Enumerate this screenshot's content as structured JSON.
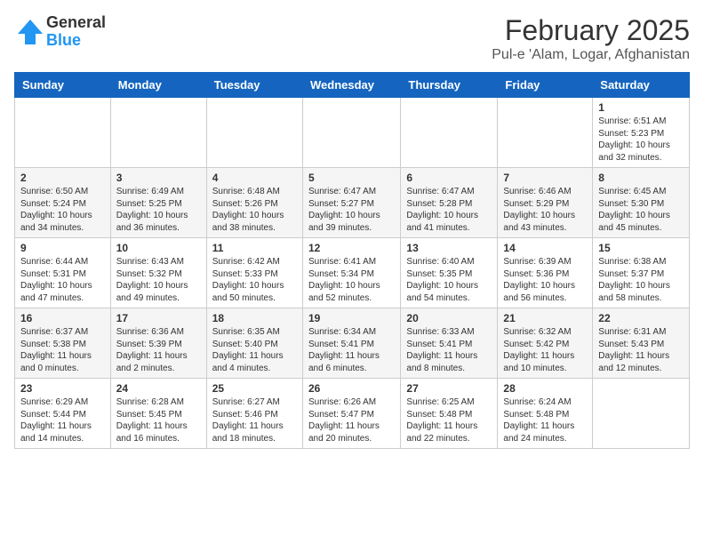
{
  "header": {
    "logo_general": "General",
    "logo_blue": "Blue",
    "title": "February 2025",
    "subtitle": "Pul-e 'Alam, Logar, Afghanistan"
  },
  "days_of_week": [
    "Sunday",
    "Monday",
    "Tuesday",
    "Wednesday",
    "Thursday",
    "Friday",
    "Saturday"
  ],
  "weeks": [
    [
      {
        "day": "",
        "info": ""
      },
      {
        "day": "",
        "info": ""
      },
      {
        "day": "",
        "info": ""
      },
      {
        "day": "",
        "info": ""
      },
      {
        "day": "",
        "info": ""
      },
      {
        "day": "",
        "info": ""
      },
      {
        "day": "1",
        "info": "Sunrise: 6:51 AM\nSunset: 5:23 PM\nDaylight: 10 hours and 32 minutes."
      }
    ],
    [
      {
        "day": "2",
        "info": "Sunrise: 6:50 AM\nSunset: 5:24 PM\nDaylight: 10 hours and 34 minutes."
      },
      {
        "day": "3",
        "info": "Sunrise: 6:49 AM\nSunset: 5:25 PM\nDaylight: 10 hours and 36 minutes."
      },
      {
        "day": "4",
        "info": "Sunrise: 6:48 AM\nSunset: 5:26 PM\nDaylight: 10 hours and 38 minutes."
      },
      {
        "day": "5",
        "info": "Sunrise: 6:47 AM\nSunset: 5:27 PM\nDaylight: 10 hours and 39 minutes."
      },
      {
        "day": "6",
        "info": "Sunrise: 6:47 AM\nSunset: 5:28 PM\nDaylight: 10 hours and 41 minutes."
      },
      {
        "day": "7",
        "info": "Sunrise: 6:46 AM\nSunset: 5:29 PM\nDaylight: 10 hours and 43 minutes."
      },
      {
        "day": "8",
        "info": "Sunrise: 6:45 AM\nSunset: 5:30 PM\nDaylight: 10 hours and 45 minutes."
      }
    ],
    [
      {
        "day": "9",
        "info": "Sunrise: 6:44 AM\nSunset: 5:31 PM\nDaylight: 10 hours and 47 minutes."
      },
      {
        "day": "10",
        "info": "Sunrise: 6:43 AM\nSunset: 5:32 PM\nDaylight: 10 hours and 49 minutes."
      },
      {
        "day": "11",
        "info": "Sunrise: 6:42 AM\nSunset: 5:33 PM\nDaylight: 10 hours and 50 minutes."
      },
      {
        "day": "12",
        "info": "Sunrise: 6:41 AM\nSunset: 5:34 PM\nDaylight: 10 hours and 52 minutes."
      },
      {
        "day": "13",
        "info": "Sunrise: 6:40 AM\nSunset: 5:35 PM\nDaylight: 10 hours and 54 minutes."
      },
      {
        "day": "14",
        "info": "Sunrise: 6:39 AM\nSunset: 5:36 PM\nDaylight: 10 hours and 56 minutes."
      },
      {
        "day": "15",
        "info": "Sunrise: 6:38 AM\nSunset: 5:37 PM\nDaylight: 10 hours and 58 minutes."
      }
    ],
    [
      {
        "day": "16",
        "info": "Sunrise: 6:37 AM\nSunset: 5:38 PM\nDaylight: 11 hours and 0 minutes."
      },
      {
        "day": "17",
        "info": "Sunrise: 6:36 AM\nSunset: 5:39 PM\nDaylight: 11 hours and 2 minutes."
      },
      {
        "day": "18",
        "info": "Sunrise: 6:35 AM\nSunset: 5:40 PM\nDaylight: 11 hours and 4 minutes."
      },
      {
        "day": "19",
        "info": "Sunrise: 6:34 AM\nSunset: 5:41 PM\nDaylight: 11 hours and 6 minutes."
      },
      {
        "day": "20",
        "info": "Sunrise: 6:33 AM\nSunset: 5:41 PM\nDaylight: 11 hours and 8 minutes."
      },
      {
        "day": "21",
        "info": "Sunrise: 6:32 AM\nSunset: 5:42 PM\nDaylight: 11 hours and 10 minutes."
      },
      {
        "day": "22",
        "info": "Sunrise: 6:31 AM\nSunset: 5:43 PM\nDaylight: 11 hours and 12 minutes."
      }
    ],
    [
      {
        "day": "23",
        "info": "Sunrise: 6:29 AM\nSunset: 5:44 PM\nDaylight: 11 hours and 14 minutes."
      },
      {
        "day": "24",
        "info": "Sunrise: 6:28 AM\nSunset: 5:45 PM\nDaylight: 11 hours and 16 minutes."
      },
      {
        "day": "25",
        "info": "Sunrise: 6:27 AM\nSunset: 5:46 PM\nDaylight: 11 hours and 18 minutes."
      },
      {
        "day": "26",
        "info": "Sunrise: 6:26 AM\nSunset: 5:47 PM\nDaylight: 11 hours and 20 minutes."
      },
      {
        "day": "27",
        "info": "Sunrise: 6:25 AM\nSunset: 5:48 PM\nDaylight: 11 hours and 22 minutes."
      },
      {
        "day": "28",
        "info": "Sunrise: 6:24 AM\nSunset: 5:48 PM\nDaylight: 11 hours and 24 minutes."
      },
      {
        "day": "",
        "info": ""
      }
    ]
  ]
}
